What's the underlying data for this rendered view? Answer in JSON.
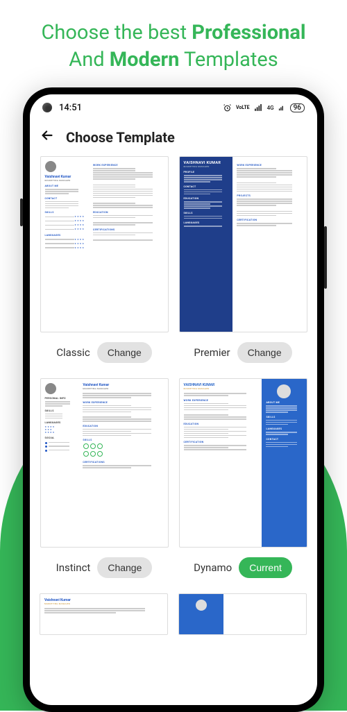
{
  "headline": {
    "part1": "Choose the best ",
    "bold1": "Professional",
    "part2": " And ",
    "bold2": "Modern",
    "part3": " Templates"
  },
  "status_bar": {
    "time": "14:51",
    "vol": "VoLTE",
    "net": "4G",
    "battery": "96"
  },
  "header": {
    "title": "Choose Template"
  },
  "templates": [
    {
      "name": "Classic",
      "action": "Change",
      "current": false
    },
    {
      "name": "Premier",
      "action": "Change",
      "current": false
    },
    {
      "name": "Instinct",
      "action": "Change",
      "current": false
    },
    {
      "name": "Dynamo",
      "action": "Current",
      "current": true
    }
  ],
  "sample": {
    "name": "Vaishnavi Kumar",
    "name_upper": "VAISHNAVI KUMAR",
    "role": "MARKETING MANAGER",
    "sections": {
      "about": "ABOUT ME",
      "work": "WORK EXPERIENCE",
      "profile": "PROFILE",
      "contact": "CONTACT",
      "education": "EDUCATION",
      "skills": "SKILLS",
      "languages": "LANGUAGES",
      "certification": "CERTIFICATION",
      "certifications": "CERTIFICATIONS",
      "projects": "PROJECTS",
      "personal": "PERSONAL INFO",
      "social": "SOCIAL"
    }
  }
}
